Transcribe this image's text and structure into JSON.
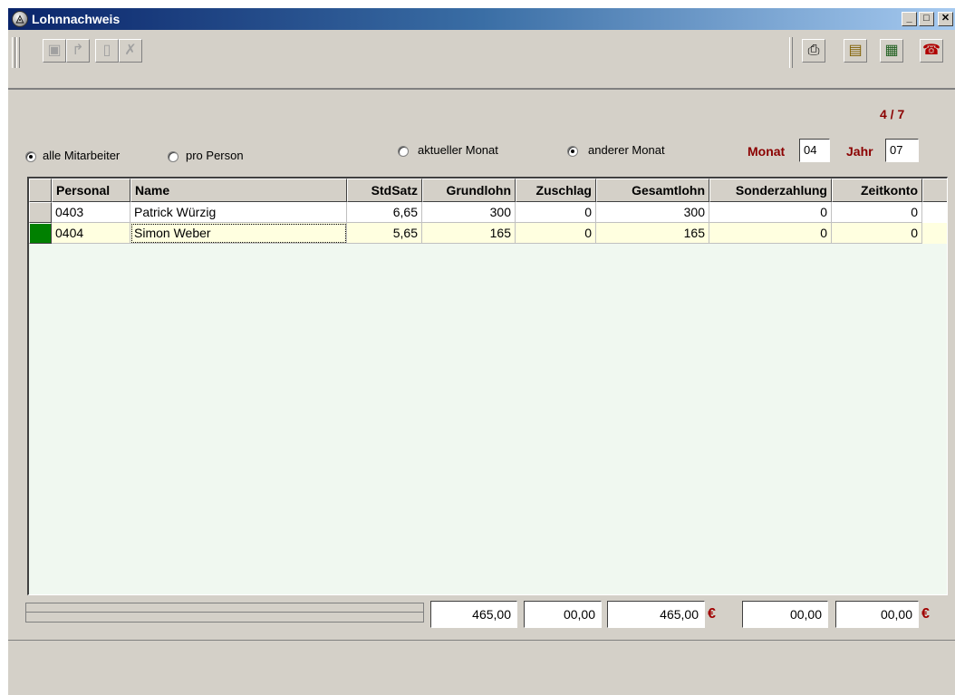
{
  "window": {
    "title": "Lohnnachweis",
    "title_icon": "app-logo-icon"
  },
  "titlebar_buttons": [
    {
      "icon": "minimize-icon",
      "glyph": "_"
    },
    {
      "icon": "maximize-icon",
      "glyph": "□"
    },
    {
      "icon": "close-icon",
      "glyph": "✕"
    }
  ],
  "toolbar": {
    "left_buttons": [
      {
        "icon": "save-icon",
        "glyph": "▣"
      },
      {
        "icon": "undo-icon",
        "glyph": "↱"
      },
      {
        "icon": "new-document-icon",
        "glyph": "▯"
      },
      {
        "icon": "delete-icon",
        "glyph": "✗"
      }
    ],
    "right_buttons": [
      {
        "icon": "print-icon",
        "glyph": "⎙"
      },
      {
        "icon": "report-icon",
        "glyph": "▤"
      },
      {
        "icon": "calculator-icon",
        "glyph": "▦"
      },
      {
        "icon": "telephone-icon",
        "glyph": "☎"
      }
    ]
  },
  "record_counter": "4 / 7",
  "filters": {
    "scope_options": [
      {
        "label": "alle Mitarbeiter",
        "selected": true
      },
      {
        "label": "pro Person",
        "selected": false
      }
    ],
    "month_options": [
      {
        "label": "aktueller Monat",
        "selected": false
      },
      {
        "label": "anderer Monat",
        "selected": true
      }
    ],
    "monat_label": "Monat",
    "monat_value": "04",
    "jahr_label": "Jahr",
    "jahr_value": "07"
  },
  "table": {
    "columns": [
      "Personal",
      "Name",
      "StdSatz",
      "Grundlohn",
      "Zuschlag",
      "Gesamtlohn",
      "Sonderzahlung",
      "Zeitkonto"
    ],
    "rows": [
      {
        "personal": "0403",
        "name": "Patrick Würzig",
        "stdsatz": "6,65",
        "grundlohn": "300",
        "zuschlag": "0",
        "gesamtlohn": "300",
        "sonderzahlung": "0",
        "zeitkonto": "0"
      },
      {
        "personal": "0404",
        "name": "Simon Weber",
        "stdsatz": "5,65",
        "grundlohn": "165",
        "zuschlag": "0",
        "gesamtlohn": "165",
        "sonderzahlung": "0",
        "zeitkonto": "0"
      }
    ],
    "selected_row": 1
  },
  "totals": {
    "grundlohn": "465,00",
    "zuschlag": "00,00",
    "gesamtlohn": "465,00",
    "sonderzahlung": "00,00",
    "zeitkonto": "00,00",
    "currency": "€"
  },
  "colors": {
    "accent": "#8b0000",
    "selected_row": "#ffffe0",
    "row_indicator": "#008000"
  }
}
